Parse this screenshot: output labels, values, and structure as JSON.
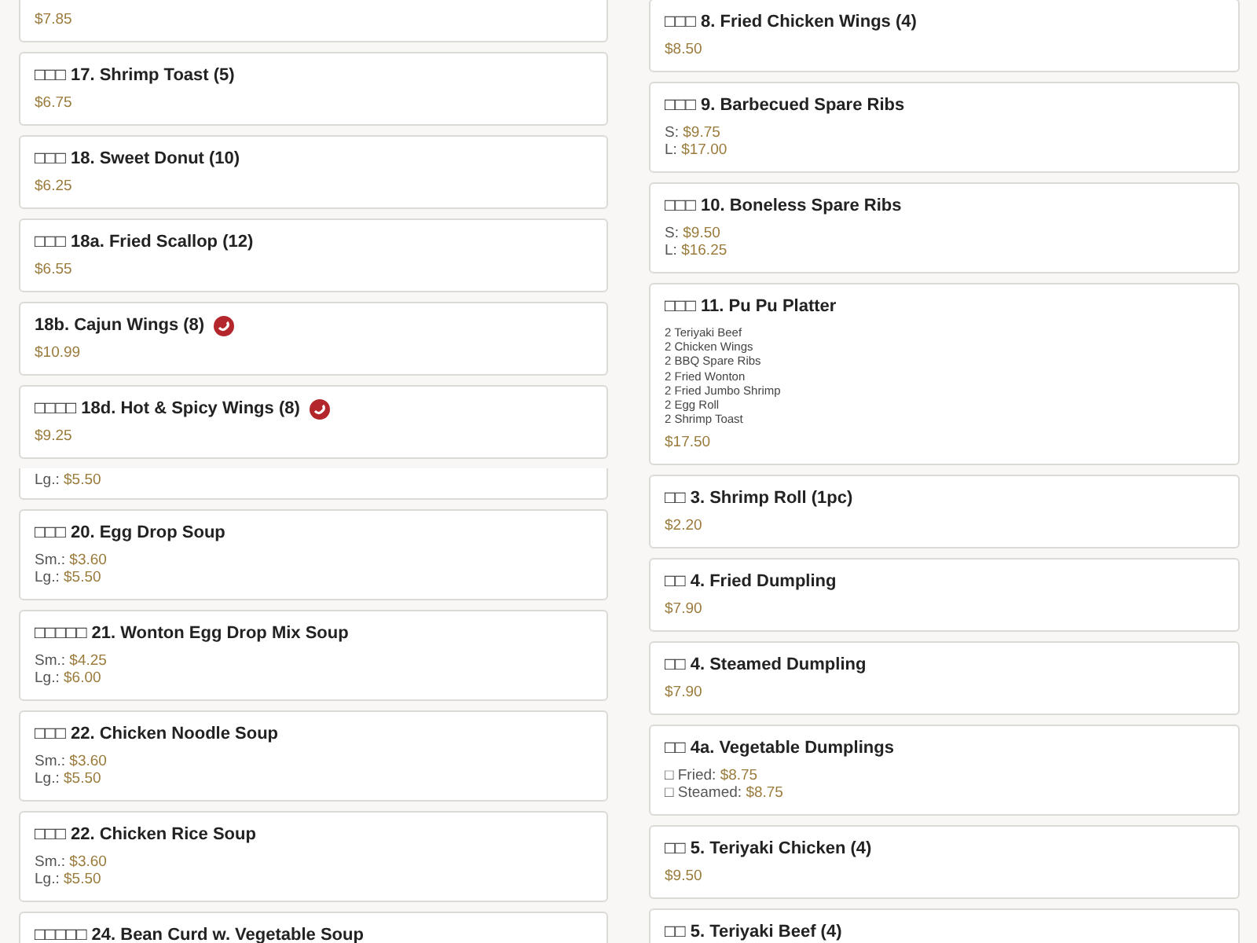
{
  "columns": [
    {
      "items": [
        {
          "kind": "item",
          "prices": [
            {
              "value": "$7.85"
            }
          ]
        },
        {
          "kind": "item",
          "title": "□□□ 17. Shrimp Toast (5)",
          "prices": [
            {
              "value": "$6.75"
            }
          ],
          "spicy": false
        },
        {
          "kind": "item",
          "title": "□□□ 18. Sweet Donut (10)",
          "prices": [
            {
              "value": "$6.25"
            }
          ],
          "spicy": false
        },
        {
          "kind": "item",
          "title": "□□□ 18a. Fried Scallop (12)",
          "prices": [
            {
              "value": "$6.55"
            }
          ],
          "spicy": false
        },
        {
          "kind": "item",
          "title": "18b. Cajun Wings (8)",
          "prices": [
            {
              "value": "$10.99"
            }
          ],
          "spicy": true
        },
        {
          "kind": "item",
          "title": "□□□□ 18d. Hot & Spicy Wings (8)",
          "prices": [
            {
              "value": "$9.25"
            }
          ],
          "spicy": true
        },
        {
          "kind": "seam",
          "prices": [
            {
              "label": "Lg.:",
              "value": "$5.50"
            }
          ]
        },
        {
          "kind": "item",
          "title": "□□□ 20. Egg Drop Soup",
          "prices": [
            {
              "label": "Sm.:",
              "value": "$3.60"
            },
            {
              "label": "Lg.:",
              "value": "$5.50"
            }
          ],
          "spicy": false
        },
        {
          "kind": "item",
          "title": "□□□□□ 21. Wonton Egg Drop Mix Soup",
          "prices": [
            {
              "label": "Sm.:",
              "value": "$4.25"
            },
            {
              "label": "Lg.:",
              "value": "$6.00"
            }
          ],
          "spicy": false
        },
        {
          "kind": "item",
          "title": "□□□ 22. Chicken Noodle Soup",
          "prices": [
            {
              "label": "Sm.:",
              "value": "$3.60"
            },
            {
              "label": "Lg.:",
              "value": "$5.50"
            }
          ],
          "spicy": false
        },
        {
          "kind": "item",
          "title": "□□□ 22. Chicken Rice Soup",
          "prices": [
            {
              "label": "Sm.:",
              "value": "$3.60"
            },
            {
              "label": "Lg.:",
              "value": "$5.50"
            }
          ],
          "spicy": false
        },
        {
          "kind": "item",
          "title": "□□□□□ 24. Bean Curd w. Vegetable Soup",
          "spicy": false
        }
      ]
    },
    {
      "items": [
        {
          "kind": "blank"
        },
        {
          "kind": "item",
          "title": "□□□ 8. Fried Chicken Wings (4)",
          "prices": [
            {
              "value": "$8.50"
            }
          ],
          "spicy": false
        },
        {
          "kind": "item",
          "title": "□□□ 9. Barbecued Spare Ribs",
          "prices": [
            {
              "label": "S:",
              "value": "$9.75"
            },
            {
              "label": "L:",
              "value": "$17.00"
            }
          ],
          "spicy": false
        },
        {
          "kind": "item",
          "title": "□□□ 10. Boneless Spare Ribs",
          "prices": [
            {
              "label": "S:",
              "value": "$9.50"
            },
            {
              "label": "L:",
              "value": "$16.25"
            }
          ],
          "spicy": false
        },
        {
          "kind": "item",
          "title": "□□□ 11. Pu Pu Platter",
          "contents": [
            "2 Teriyaki Beef",
            "2 Chicken Wings",
            "2 BBQ Spare Ribs",
            "2 Fried Wonton",
            "2 Fried Jumbo Shrimp",
            "2 Egg Roll",
            "2 Shrimp Toast"
          ],
          "prices": [
            {
              "value": "$17.50"
            }
          ],
          "spicy": false
        },
        {
          "kind": "item",
          "title": "□□ 3. Shrimp Roll (1pc)",
          "prices": [
            {
              "value": "$2.20"
            }
          ],
          "spicy": false
        },
        {
          "kind": "item",
          "title": "□□ 4. Fried Dumpling",
          "prices": [
            {
              "value": "$7.90"
            }
          ],
          "spicy": false
        },
        {
          "kind": "item",
          "title": "□□ 4. Steamed Dumpling",
          "prices": [
            {
              "value": "$7.90"
            }
          ],
          "spicy": false
        },
        {
          "kind": "item",
          "title": "□□ 4a. Vegetable Dumplings",
          "prices": [
            {
              "label": "□ Fried:",
              "value": "$8.75"
            },
            {
              "label": "□ Steamed:",
              "value": "$8.75"
            }
          ],
          "spicy": false
        },
        {
          "kind": "item",
          "title": "□□ 5. Teriyaki Chicken (4)",
          "prices": [
            {
              "value": "$9.50"
            }
          ],
          "spicy": false
        },
        {
          "kind": "item",
          "title": "□□ 5. Teriyaki Beef (4)",
          "spicy": false
        }
      ]
    }
  ]
}
